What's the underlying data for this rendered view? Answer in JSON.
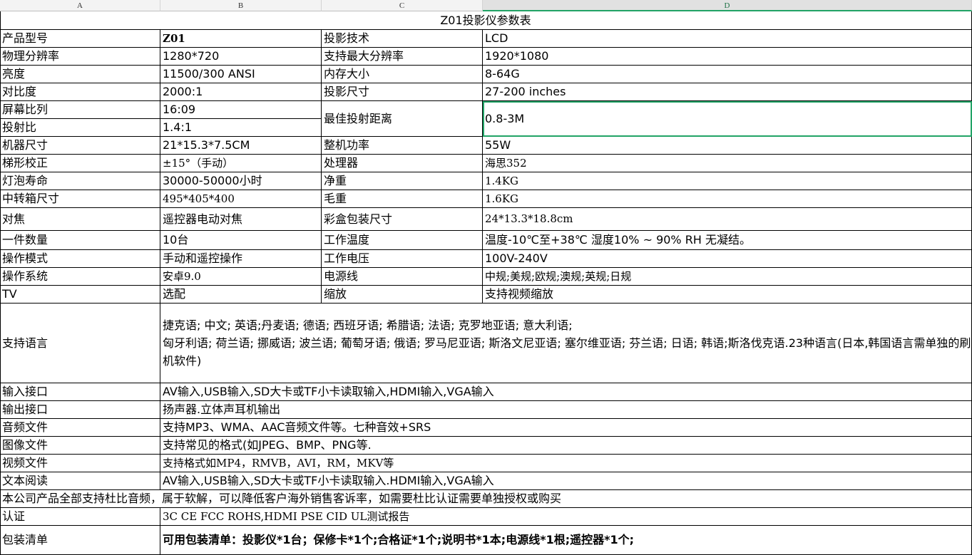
{
  "column_headers": [
    "A",
    "B",
    "C",
    "D"
  ],
  "title": "Z01投影仪参数表",
  "rows": [
    {
      "a": "产品型号",
      "b": "Z01",
      "c": "投影技术",
      "d": "LCD"
    },
    {
      "a": "物理分辨率",
      "b": "1280*720",
      "c": "支持最大分辨率",
      "d": "1920*1080"
    },
    {
      "a": "亮度",
      "b": "11500/300 ANSI",
      "c": "内存大小",
      "d": "8-64G"
    },
    {
      "a": "对比度",
      "b": "2000:1",
      "c": "投影尺寸",
      "d": "27-200 inches"
    },
    {
      "a": "屏幕比列",
      "b": "16:09"
    },
    {
      "a": "投射比",
      "b": "1.4:1"
    },
    {
      "a": "机器尺寸",
      "b": "21*15.3*7.5CM",
      "c": "整机功率",
      "d": "55W"
    },
    {
      "a": "梯形校正",
      "b": "±15°（手动）",
      "c": "处理器",
      "d": "海思352"
    },
    {
      "a": "灯泡寿命",
      "b": "30000-50000小时",
      "c": "净重",
      "d": "1.4KG"
    },
    {
      "a": "中转箱尺寸",
      "b": "495*405*400",
      "c": "毛重",
      "d": "1.6KG"
    },
    {
      "a": "对焦",
      "b": "遥控器电动对焦",
      "c": "彩盒包装尺寸",
      "d": "24*13.3*18.8cm"
    },
    {
      "a": "一件数量",
      "b": "10台",
      "c": "工作温度",
      "d": "温度-10℃至+38℃     湿度10% ~ 90% RH 无凝结。"
    },
    {
      "a": "操作模式",
      "b": "手动和遥控操作",
      "c": "工作电压",
      "d": "100V-240V"
    },
    {
      "a": "操作系统",
      "b": "安卓9.0",
      "c": "电源线",
      "d": "中规;美规;欧规;澳规;英规;日规"
    },
    {
      "a": "TV",
      "b": "选配",
      "c": "缩放",
      "d": "支持视频缩放"
    }
  ],
  "merged_c": {
    "label": "最佳投射距离",
    "value": "0.8-3M"
  },
  "languages": {
    "label": "支持语言",
    "line1": "捷克语; 中文; 英语;丹麦语; 德语; 西班牙语; 希腊语; 法语; 克罗地亚语; 意大利语;",
    "line2": "匈牙利语; 荷兰语; 挪威语; 波兰语; 葡萄牙语; 俄语; 罗马尼亚语; 斯洛文尼亚语; 塞尔维亚语; 芬兰语; 日语; 韩语;斯洛伐克语.23种语言(日本,韩国语言需单独的刷机软件)"
  },
  "rows2": [
    {
      "a": "输入接口",
      "b": "AV输入,USB输入,SD大卡或TF小卡读取输入,HDMI输入,VGA输入"
    },
    {
      "a": "输出接口",
      "b": "扬声器.立体声耳机输出"
    },
    {
      "a": "音频文件",
      "b": "支持MP3、WMA、AAC音频文件等。七种音效+SRS"
    },
    {
      "a": "图像文件",
      "b": "支持常见的格式(如JPEG、BMP、PNG等."
    },
    {
      "a": "视频文件",
      "b": "支持格式如MP4，RMVB，AVI，RM，MKV等"
    },
    {
      "a": "文本阅读",
      "b": "AV输入,USB输入,SD大卡或TF小卡读取输入.HDMI输入,VGA输入"
    }
  ],
  "note": "本公司产品全部支持杜比音频，属于软解，可以降低客户海外销售客诉率，如需要杜比认证需要单独授权或购买",
  "certification": {
    "label": "认证",
    "value": " 3C CE FCC ROHS,HDMI PSE CID UL测试报告"
  },
  "packing": {
    "label": "包装清单",
    "value": "可用包装清单：投影仪*1台；保修卡*1个;合格证*1个;说明书*1本;电源线*1根;遥控器*1个;"
  }
}
